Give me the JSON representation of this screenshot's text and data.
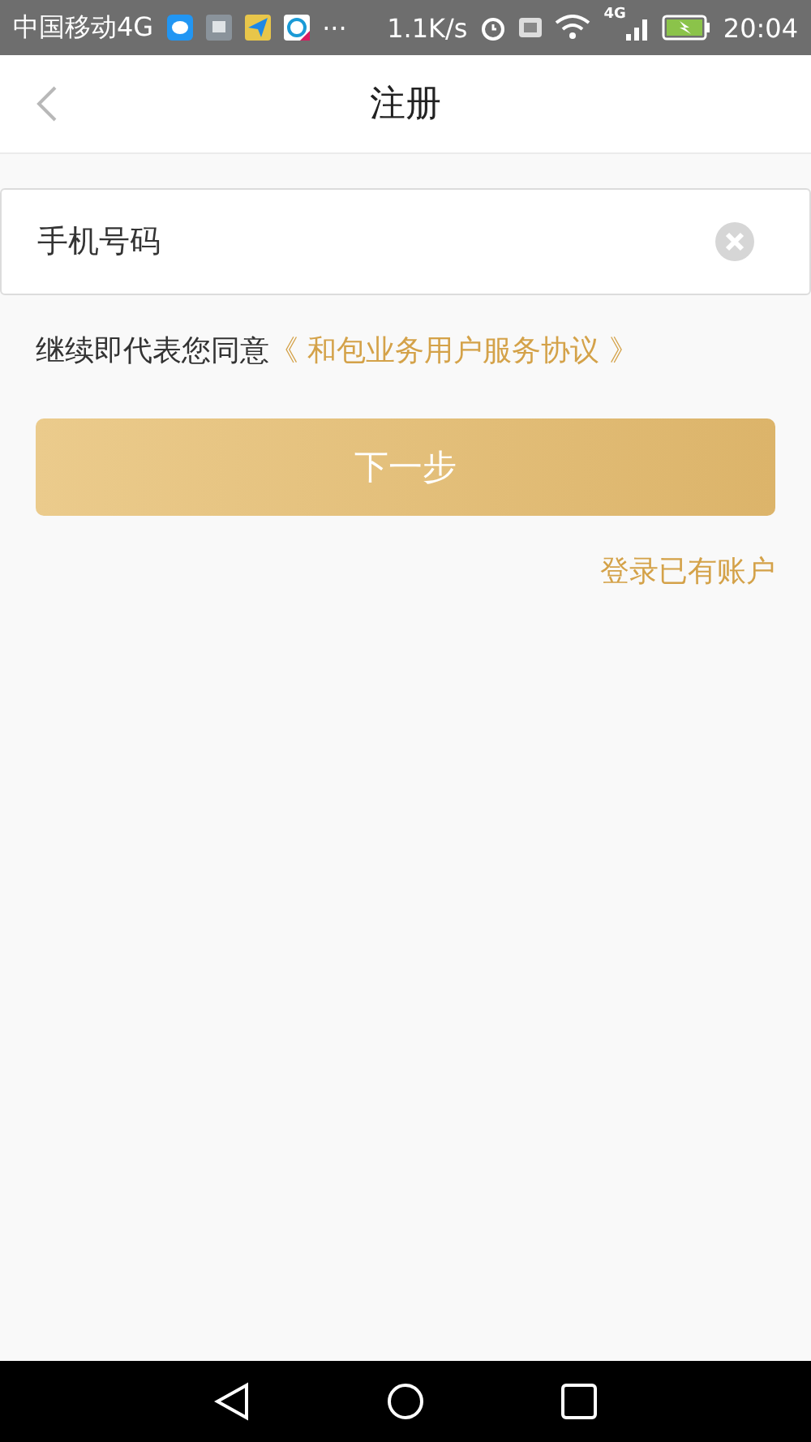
{
  "status_bar": {
    "carrier": "中国移动4G",
    "more": "···",
    "speed": "1.1K/s",
    "network": "4G",
    "time": "20:04"
  },
  "header": {
    "title": "注册"
  },
  "phone_field": {
    "placeholder": "手机号码"
  },
  "agreement": {
    "text": "继续即代表您同意",
    "link": "《 和包业务用户服务协议 》"
  },
  "next_button": {
    "label": "下一步"
  },
  "login_link": "登录已有账户"
}
